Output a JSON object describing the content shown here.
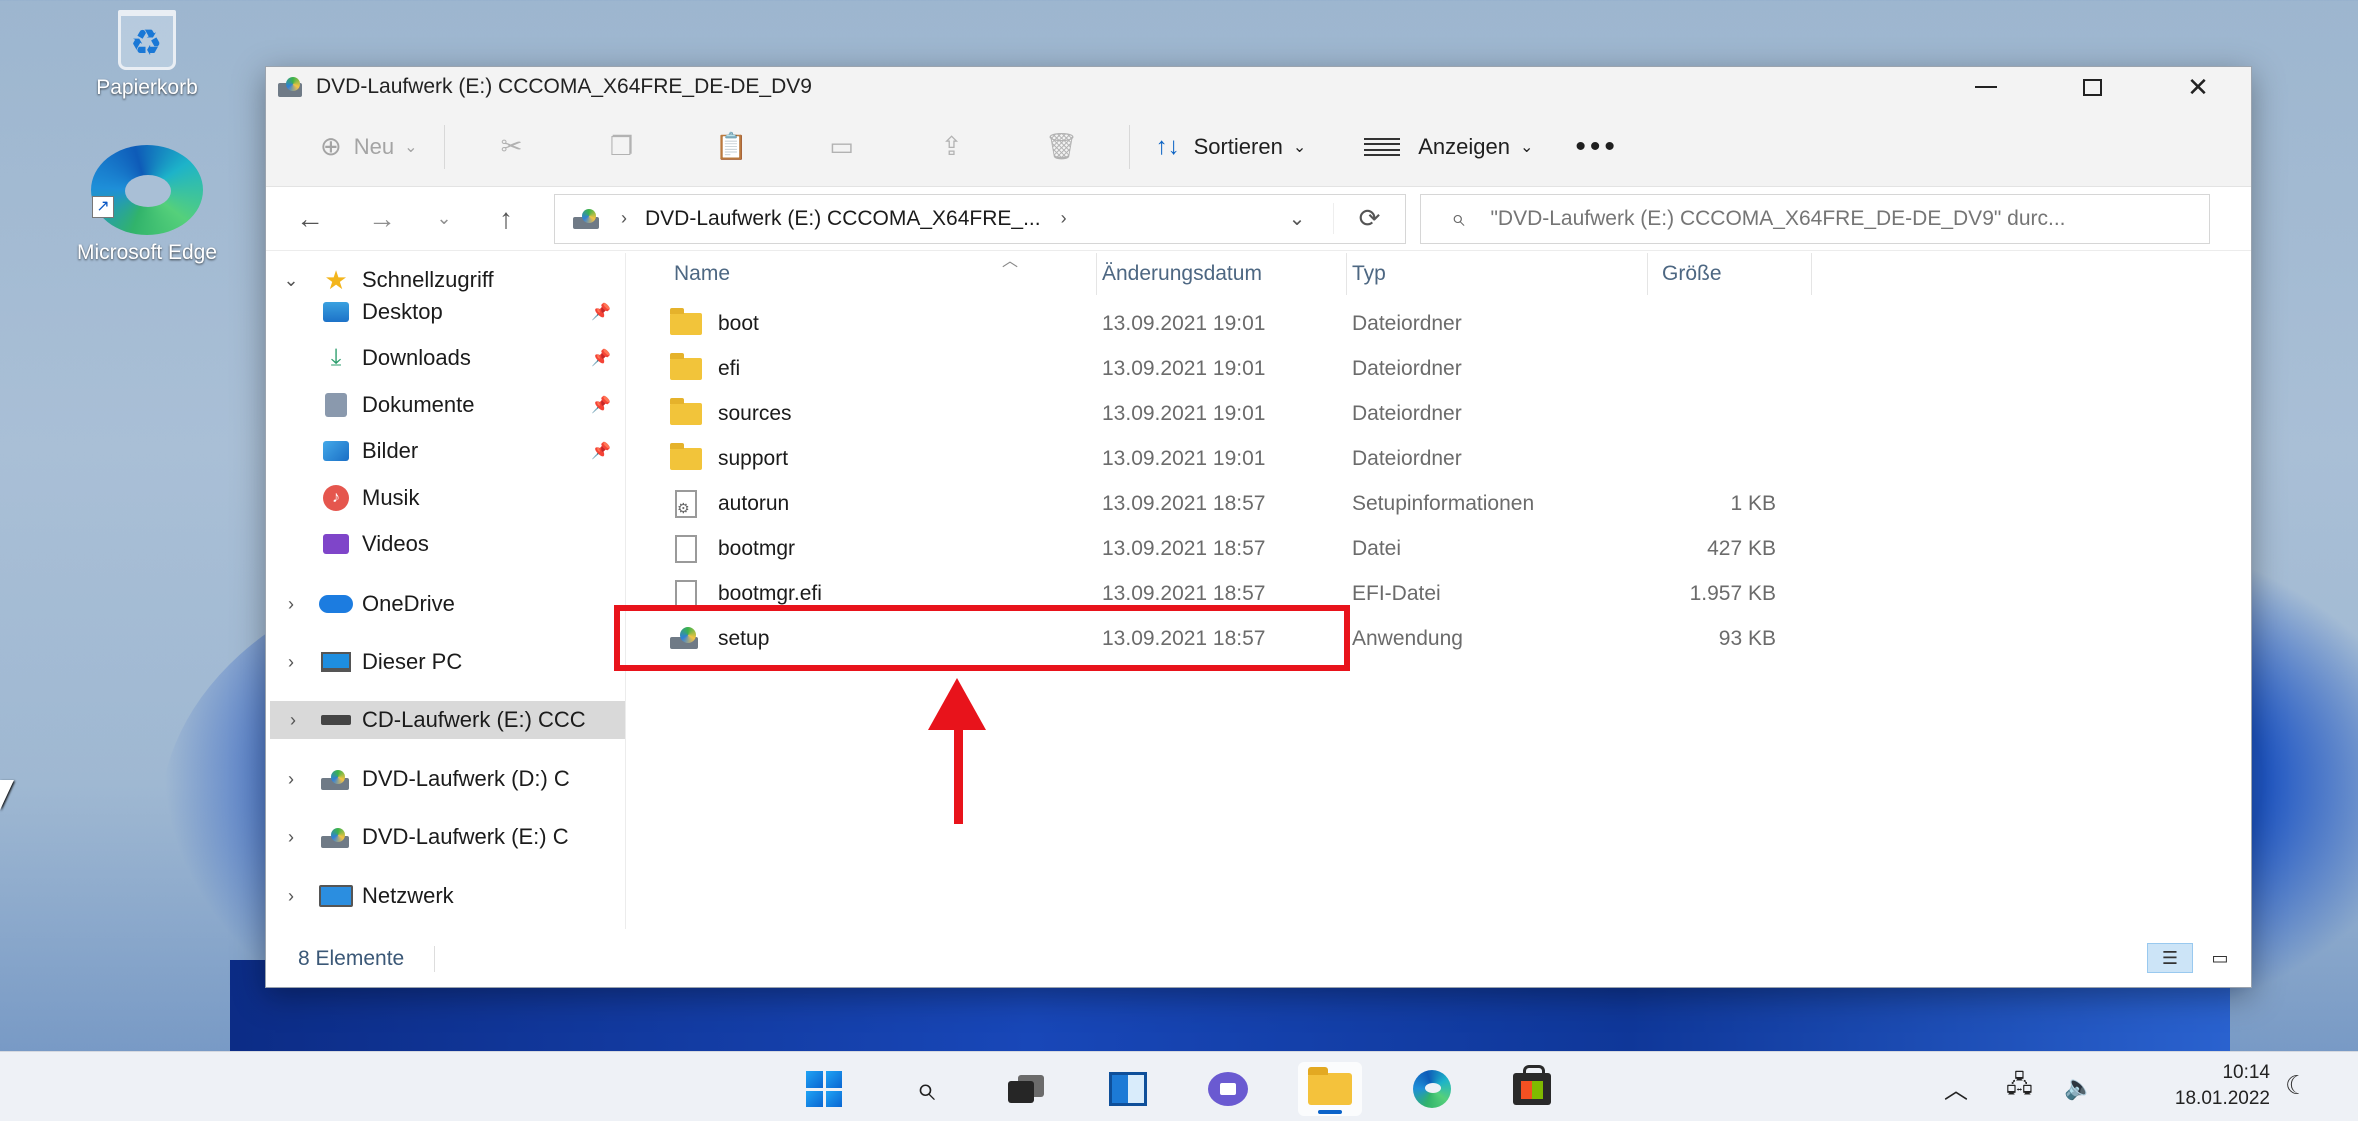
{
  "desktop": {
    "icons": [
      {
        "label": "Papierkorb",
        "icon": "recycle-bin-icon"
      },
      {
        "label": "Microsoft Edge",
        "icon": "edge-icon"
      }
    ]
  },
  "window": {
    "title": "DVD-Laufwerk (E:) CCCOMA_X64FRE_DE-DE_DV9",
    "controls": {
      "minimize": "—",
      "maximize": "□",
      "close": "✕"
    }
  },
  "toolbar": {
    "new_label": "Neu",
    "sort_label": "Sortieren",
    "view_label": "Anzeigen",
    "more_label": "•••"
  },
  "navigation": {
    "address_path": "DVD-Laufwerk (E:) CCCOMA_X64FRE_...",
    "search_placeholder": "\"DVD-Laufwerk (E:) CCCOMA_X64FRE_DE-DE_DV9\" durc..."
  },
  "sidebar": {
    "quick_access": "Schnellzugriff",
    "items": [
      {
        "label": "Desktop",
        "pinned": true
      },
      {
        "label": "Downloads",
        "pinned": true
      },
      {
        "label": "Dokumente",
        "pinned": true
      },
      {
        "label": "Bilder",
        "pinned": true
      },
      {
        "label": "Musik",
        "pinned": false
      },
      {
        "label": "Videos",
        "pinned": false
      }
    ],
    "roots": [
      {
        "label": "OneDrive"
      },
      {
        "label": "Dieser PC"
      },
      {
        "label": "CD-Laufwerk (E:) CCC",
        "selected": true
      },
      {
        "label": "DVD-Laufwerk (D:) C"
      },
      {
        "label": "DVD-Laufwerk (E:) C"
      },
      {
        "label": "Netzwerk"
      }
    ]
  },
  "filelist": {
    "columns": [
      "Name",
      "Änderungsdatum",
      "Typ",
      "Größe"
    ],
    "rows": [
      {
        "name": "boot",
        "date": "13.09.2021 19:01",
        "type": "Dateiordner",
        "size": "",
        "kind": "folder"
      },
      {
        "name": "efi",
        "date": "13.09.2021 19:01",
        "type": "Dateiordner",
        "size": "",
        "kind": "folder"
      },
      {
        "name": "sources",
        "date": "13.09.2021 19:01",
        "type": "Dateiordner",
        "size": "",
        "kind": "folder"
      },
      {
        "name": "support",
        "date": "13.09.2021 19:01",
        "type": "Dateiordner",
        "size": "",
        "kind": "folder"
      },
      {
        "name": "autorun",
        "date": "13.09.2021 18:57",
        "type": "Setupinformationen",
        "size": "1 KB",
        "kind": "setup-info"
      },
      {
        "name": "bootmgr",
        "date": "13.09.2021 18:57",
        "type": "Datei",
        "size": "427 KB",
        "kind": "file"
      },
      {
        "name": "bootmgr.efi",
        "date": "13.09.2021 18:57",
        "type": "EFI-Datei",
        "size": "1.957 KB",
        "kind": "file"
      },
      {
        "name": "setup",
        "date": "13.09.2021 18:57",
        "type": "Anwendung",
        "size": "93 KB",
        "kind": "application"
      }
    ]
  },
  "status": {
    "count": "8 Elemente"
  },
  "taskbar": {
    "apps": [
      "start-icon",
      "search-icon",
      "task-view-icon",
      "widgets-icon",
      "chat-icon",
      "file-explorer-icon",
      "edge-icon",
      "store-icon"
    ],
    "time": "10:14",
    "date": "18.01.2022"
  },
  "colors": {
    "annotation_red": "#e8131b",
    "accent": "#0a62c9"
  }
}
